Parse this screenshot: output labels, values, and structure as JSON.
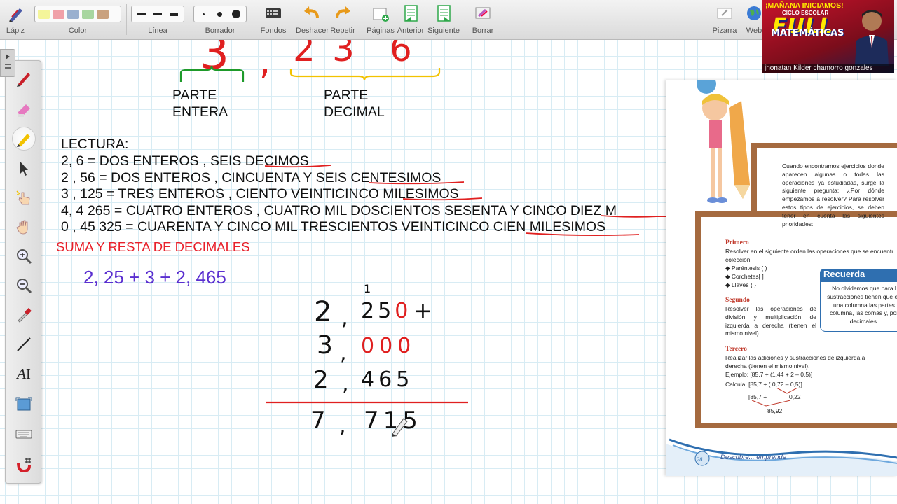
{
  "toolbar": {
    "lapiz": "Lápiz",
    "color": "Color",
    "linea": "Línea",
    "borrador": "Borrador",
    "fondos": "Fondos",
    "deshacer": "Deshacer",
    "repetir": "Repetir",
    "paginas": "Páginas",
    "anterior": "Anterior",
    "siguiente": "Siguiente",
    "borrar": "Borrar",
    "pizarra": "Pizarra",
    "web": "Web",
    "swatch_colors": [
      "#f4f59a",
      "#f0a0a8",
      "#9ab0cf",
      "#a8d6a0",
      "#c9a17e"
    ]
  },
  "left_tools": [
    "pen-icon",
    "highlighter-icon",
    "marker-icon",
    "pointer-icon",
    "hand-pointer-icon",
    "hand-icon",
    "zoom-in-icon",
    "zoom-out-icon",
    "eyedropper-icon",
    "line-icon",
    "text-icon",
    "screenshot-icon",
    "keyboard-icon",
    "magnet-icon"
  ],
  "board": {
    "top_number": {
      "integer": "3",
      "comma": ",",
      "decimals": [
        "2",
        "3",
        "6"
      ]
    },
    "parte_entera": [
      "PARTE",
      "ENTERA"
    ],
    "parte_decimal": [
      "PARTE",
      "DECIMAL"
    ],
    "lectura_title": "LECTURA:",
    "lines": [
      {
        "left": " 2, 6  = DOS ENTEROS , SEIS ",
        "underlined": "DECIMOS"
      },
      {
        "left": "2 , 56 = DOS ENTEROS , CINCUENTA Y SEIS C",
        "underlined": "ENTESIMOS"
      },
      {
        "left": "3 , 125 = TRES ENTEROS , CIENTO VEINTICINCO ",
        "underlined": "MILESIMOS"
      },
      {
        "left": "4, 4 265 = CUATRO ENTEROS , CUATRO MIL DOSCIENTOS SESENTA Y CINCO ",
        "underlined": "DIEZ M"
      },
      {
        "left": "0 , 45 325 = CUARENTA Y CINCO MIL TRESCIENTOS VEINTICINCO ",
        "underlined": "CIEN MILESIMOS"
      }
    ],
    "suma_title": "SUMA Y RESTA DE DECIMALES",
    "expression": "2, 25  + 3 + 2, 465",
    "carry": "1",
    "rows": [
      {
        "int": "2",
        "comma": ",",
        "digits": [
          "2",
          "5"
        ],
        "added": "0",
        "op": "+"
      },
      {
        "int": "3",
        "comma": ",",
        "digits": [],
        "added": "000",
        "op": ""
      },
      {
        "int": "2",
        "comma": ",",
        "digits": [
          "4",
          "6",
          "5"
        ],
        "added": "",
        "op": ""
      }
    ],
    "result": {
      "int": "7",
      "comma": ",",
      "digits": "715"
    }
  },
  "book": {
    "intro": "Cuando encontramos ejercicios donde aparecen algunas o todas las operaciones ya estudiadas, surge la siguiente pregunta: ¿Por dónde empezamos a resolver? Para resolver estos tipos de ejercicios, se deben tener en cuenta las siguientes prioridades:",
    "primero_head": "Primero",
    "primero_text": "Resolver en el siguiente orden las operaciones que se encuentr colección:",
    "bullets": [
      "Paréntesis    (   )",
      "Corchetes[    ]",
      "Llaves      {     }"
    ],
    "segundo_head": "Segundo",
    "segundo_text": "Resolver las operaciones de división y multiplicación de izquierda a derecha (tienen el mismo nivel).",
    "tercero_head": "Tercero",
    "tercero_text": "Realizar las adiciones y sustracciones de izquierda a derecha (tienen el mismo nivel).",
    "ejemplo": "Ejemplo: [85,7 + (1,44 + 2 – 0,5)]",
    "calcula": "Calcula: [85,7 + (   0,72   – 0,5)]",
    "calc2_left": "[85,7 +",
    "calc2_right": "0,22",
    "calc3": "85,92",
    "recuerda": "Recuerda",
    "recuerda_text": "No olvidemos que para l sustracciones tienen que en una columna las partes columna, las comas y, por decimales.",
    "page_number": "28",
    "footer": "Descubre... emprende"
  },
  "video": {
    "line1": "¡MAÑANA INICIAMOS!",
    "line2": "CICLO ESCOLAR",
    "line3": "FULL",
    "line4": "MATEMÁTICAS",
    "caption": "jhonatan Kilder chamorro gonzales"
  }
}
